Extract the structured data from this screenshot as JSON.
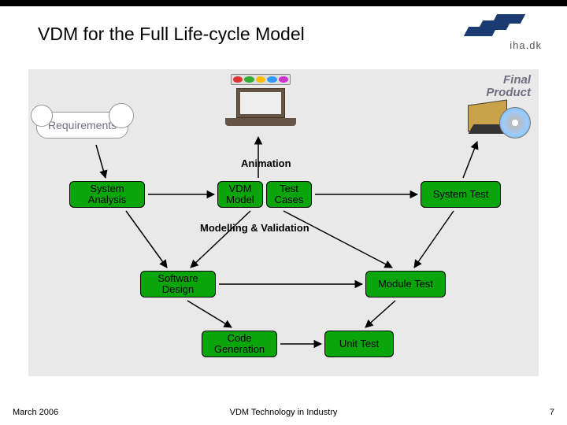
{
  "slide": {
    "title": "VDM for the Full Life-cycle Model",
    "logo_text": "iha.dk",
    "footer_left": "March 2006",
    "footer_center": "VDM Technology in Industry",
    "footer_right": "7"
  },
  "diagram": {
    "requirements": "Requirements",
    "final_product_l1": "Final",
    "final_product_l2": "Product",
    "captions": {
      "animation": "Animation",
      "modelling": "Modelling & Validation"
    },
    "nodes": {
      "system_analysis_l1": "System",
      "system_analysis_l2": "Analysis",
      "vdm_model_l1": "VDM",
      "vdm_model_l2": "Model",
      "test_cases_l1": "Test",
      "test_cases_l2": "Cases",
      "system_test": "System Test",
      "software_design_l1": "Software",
      "software_design_l2": "Design",
      "module_test": "Module Test",
      "code_gen_l1": "Code",
      "code_gen_l2": "Generation",
      "unit_test": "Unit Test"
    }
  }
}
